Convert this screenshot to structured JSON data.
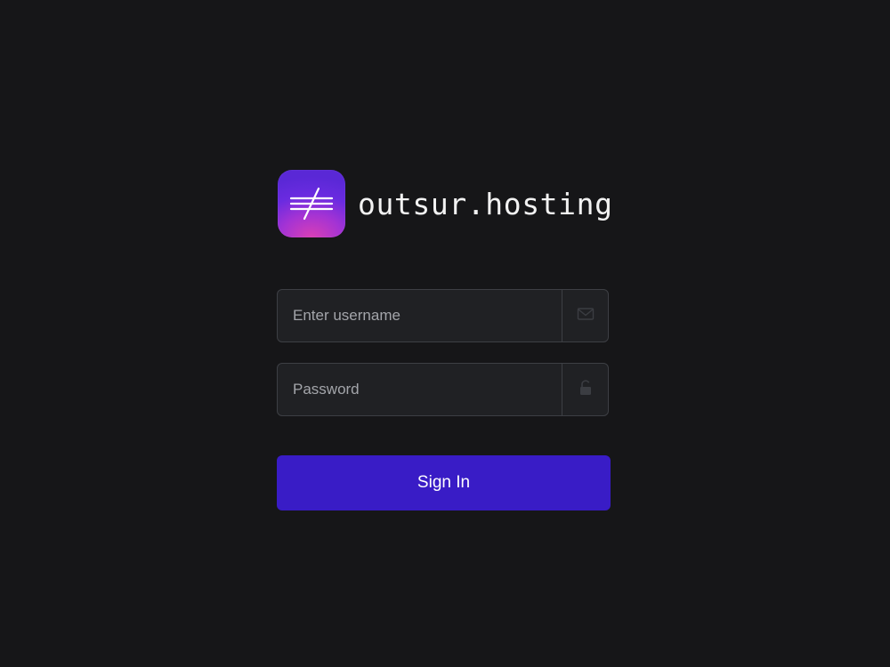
{
  "brand": {
    "name": "outsur.hosting",
    "logo_icon": "not-equal-lines-icon",
    "logo_gradient": [
      "#5a28d6",
      "#a433d4",
      "#d93fb5"
    ]
  },
  "form": {
    "username": {
      "placeholder": "Enter username",
      "value": "",
      "icon": "envelope-icon"
    },
    "password": {
      "placeholder": "Password",
      "value": "",
      "icon": "unlock-icon"
    },
    "submit_label": "Sign In"
  },
  "colors": {
    "background": "#161618",
    "field_background": "#202124",
    "field_border": "#3d3f44",
    "button": "#391cc6",
    "text": "#f2f2f2",
    "placeholder": "#a3a5aa"
  }
}
